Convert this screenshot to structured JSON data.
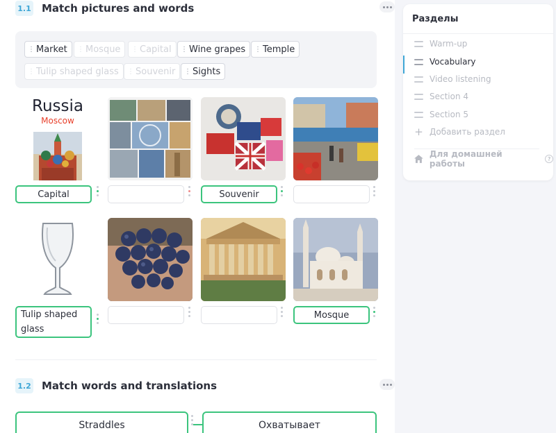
{
  "exercise1": {
    "number": "1.1",
    "title": "Match pictures and words",
    "word_bank": [
      {
        "label": "Market",
        "used": false
      },
      {
        "label": "Mosque",
        "used": true
      },
      {
        "label": "Capital",
        "used": true
      },
      {
        "label": "Wine grapes",
        "used": false
      },
      {
        "label": "Temple",
        "used": false
      },
      {
        "label": "Tulip shaped glass",
        "used": true
      },
      {
        "label": "Souvenir",
        "used": true
      },
      {
        "label": "Sights",
        "used": false
      }
    ],
    "cards": [
      {
        "image": "russia-moscow-cathedral",
        "image_text_title": "Russia",
        "image_text_subtitle": "Moscow",
        "answer": "Capital"
      },
      {
        "image": "london-sights-collage",
        "answer": ""
      },
      {
        "image": "london-souvenirs",
        "answer": "Souvenir"
      },
      {
        "image": "street-market",
        "answer": ""
      },
      {
        "image": "tulip-glass",
        "answer": "Tulip shaped glass"
      },
      {
        "image": "wine-grapes",
        "answer": ""
      },
      {
        "image": "greek-temple",
        "answer": ""
      },
      {
        "image": "mosque",
        "answer": "Mosque"
      }
    ]
  },
  "exercise2": {
    "number": "1.2",
    "title": "Match words and translations",
    "pairs": [
      {
        "word": "Straddles",
        "translation": "Охватывает"
      }
    ]
  },
  "sidebar": {
    "title": "Разделы",
    "items": [
      {
        "label": "Warm-up",
        "active": false
      },
      {
        "label": "Vocabulary",
        "active": true
      },
      {
        "label": "Video listening",
        "active": false
      },
      {
        "label": "Section 4",
        "active": false
      },
      {
        "label": "Section 5",
        "active": false
      }
    ],
    "add_section": "Добавить раздел",
    "homework": "Для домашней работы",
    "help": "?"
  },
  "colors": {
    "accent_green": "#3bc47d",
    "accent_blue": "#3ea6d6",
    "moscow_red": "#e8402b"
  }
}
